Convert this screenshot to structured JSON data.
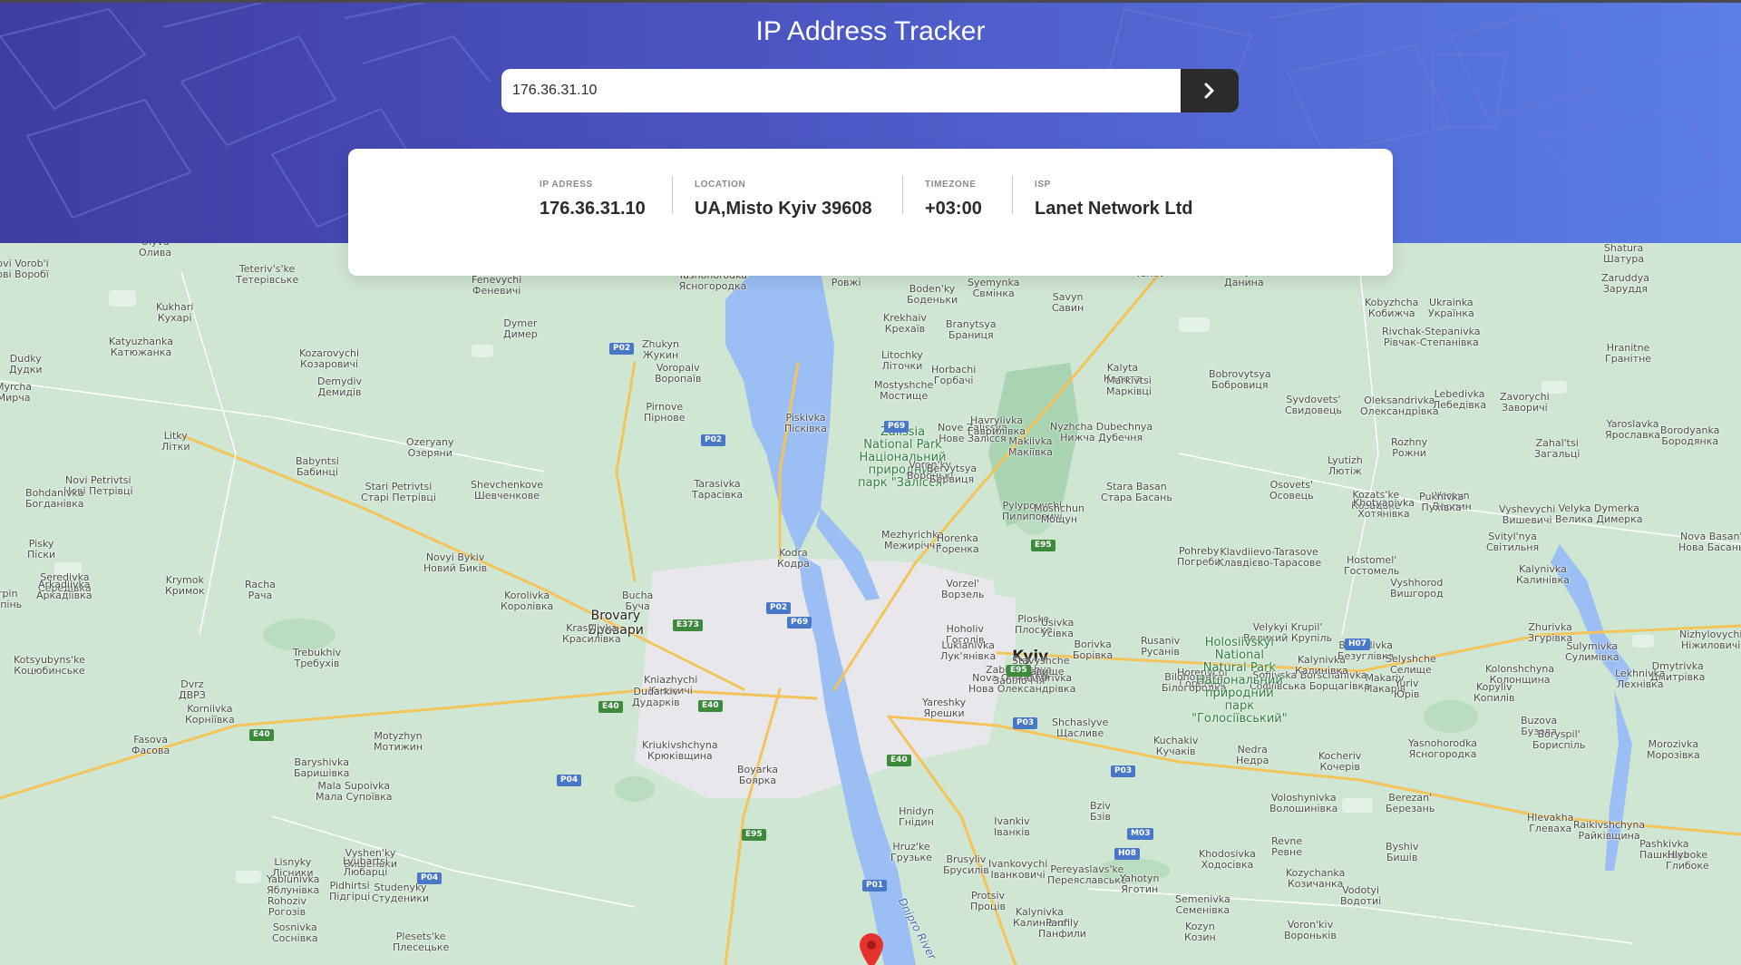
{
  "header": {
    "title": "IP Address Tracker",
    "search": {
      "value": "176.36.31.10",
      "placeholder": ""
    },
    "submit_icon": "chevron-right-icon"
  },
  "info": [
    {
      "label": "IP ADRESS",
      "value": "176.36.31.10"
    },
    {
      "label": "LOCATION",
      "value": "UA,Misto Kyiv 39608"
    },
    {
      "label": "TIMEZONE",
      "value": "+03:00"
    },
    {
      "label": "ISP",
      "value": "Lanet Network Ltd"
    }
  ],
  "colors": {
    "header_gradient_start": "#3f3ca0",
    "header_gradient_end": "#5b7ee6",
    "button_dark": "#2b2b2b",
    "map_green": "#cfe6d2",
    "water": "#9bbff4",
    "urban": "#e8e8ec",
    "marker_red": "#e5322d"
  },
  "map": {
    "marker_icon": "location-pin-icon",
    "labels": [
      {
        "text": "Olyva\nОлива",
        "cls": ""
      },
      {
        "text": "Novi Vorob'i\nНові Воробї",
        "cls": ""
      },
      {
        "text": "Teteriv's'ke\nТетерівське",
        "cls": ""
      },
      {
        "text": "Kukhari\nКухарі",
        "cls": ""
      },
      {
        "text": "Fenevychi\nФеневичі",
        "cls": ""
      },
      {
        "text": "Yasnohorodka\nЯсногородка",
        "cls": ""
      },
      {
        "text": "Rovzhi\nРовжі",
        "cls": ""
      },
      {
        "text": "Boden'ky\nБоденьки",
        "cls": ""
      },
      {
        "text": "Syemynka\nСвмінка",
        "cls": ""
      },
      {
        "text": "Savyn\nСавин",
        "cls": ""
      },
      {
        "text": "Yerkiv",
        "cls": ""
      },
      {
        "text": "Danyna\nДанина",
        "cls": ""
      },
      {
        "text": "Shatura\nШатура",
        "cls": ""
      },
      {
        "text": "Zaruddya\nЗаруддя",
        "cls": ""
      },
      {
        "text": "Katyuzhanka\nКатюжанка",
        "cls": ""
      },
      {
        "text": "Dymer\nДимер",
        "cls": ""
      },
      {
        "text": "Zhukyn\nЖукин",
        "cls": ""
      },
      {
        "text": "Krekhaiv\nКрехаїв",
        "cls": ""
      },
      {
        "text": "Branytsya\nБраниця",
        "cls": ""
      },
      {
        "text": "Kobyzhcha\nКобижча",
        "cls": ""
      },
      {
        "text": "Ukrainka\nУкраїнка",
        "cls": ""
      },
      {
        "text": "Dudky\nДудки",
        "cls": ""
      },
      {
        "text": "Kozarovychi\nКозаровичі",
        "cls": ""
      },
      {
        "text": "Voropaiv\nВоропаїв",
        "cls": ""
      },
      {
        "text": "Litochky\nЛіточки",
        "cls": ""
      },
      {
        "text": "Horbachi\nГорбачі",
        "cls": ""
      },
      {
        "text": "Rivchak-Stepanivka\nРівчак-Степанівка",
        "cls": ""
      },
      {
        "text": "Hranitne\nГранітне",
        "cls": ""
      },
      {
        "text": "Myrcha\nМирча",
        "cls": ""
      },
      {
        "text": "Demydiv\nДемидів",
        "cls": ""
      },
      {
        "text": "Pirnove\nПірнове",
        "cls": ""
      },
      {
        "text": "Mostyshche\nМостище",
        "cls": ""
      },
      {
        "text": "Kalyta\nКалита",
        "cls": ""
      },
      {
        "text": "Markivtsi\nМарківці",
        "cls": ""
      },
      {
        "text": "Bobrovytsya\nБобровиця",
        "cls": ""
      },
      {
        "text": "Syvdovets'\nСвидовець",
        "cls": ""
      },
      {
        "text": "Oleksandrivka\nОлександрівка",
        "cls": ""
      },
      {
        "text": "Lebedivka\nЛебедівка",
        "cls": ""
      },
      {
        "text": "Zavorychi\nЗаворичі",
        "cls": ""
      },
      {
        "text": "Piskivka\nПісківка",
        "cls": ""
      },
      {
        "text": "Nyzhcha Dubechnya\nНижча Дубечня",
        "cls": ""
      },
      {
        "text": "Litky\nЛітки",
        "cls": ""
      },
      {
        "text": "Zalissia\nNational Park\nНаціональний\nприродний\nпарк \"Залісся\"",
        "cls": "park"
      },
      {
        "text": "Nove Zalissya\nНове Залісся",
        "cls": ""
      },
      {
        "text": "Havrylivka\nГаврилівка",
        "cls": ""
      },
      {
        "text": "Lyutizh\nЛютіж",
        "cls": ""
      },
      {
        "text": "Rozhny\nРожни",
        "cls": ""
      },
      {
        "text": "Yaroslavka\nЯрославка",
        "cls": ""
      },
      {
        "text": "Ozeryany\nОзеряни",
        "cls": ""
      },
      {
        "text": "Voron'ky\nВоронькі",
        "cls": ""
      },
      {
        "text": "Makiivka\nМакіївка",
        "cls": ""
      },
      {
        "text": "Zahal'tsi\nЗагальці",
        "cls": ""
      },
      {
        "text": "Borodyanka\nБородянка",
        "cls": ""
      },
      {
        "text": "Babyntsi\nБабинці",
        "cls": ""
      },
      {
        "text": "Stari Petrivtsi\nСтарі Петрівці",
        "cls": ""
      },
      {
        "text": "Shevchenkove\nШевченкове",
        "cls": ""
      },
      {
        "text": "Bervytsya\nБервиця",
        "cls": ""
      },
      {
        "text": "Stara Basan\nСтара Басань",
        "cls": ""
      },
      {
        "text": "Osovets'\nОсовець",
        "cls": ""
      },
      {
        "text": "Kozats'ke\nКозацьке",
        "cls": ""
      },
      {
        "text": "Verpyn\nВерпин",
        "cls": ""
      },
      {
        "text": "Vyshevychi\nВишевичі",
        "cls": ""
      },
      {
        "text": "Novi Petrivtsi\nНові Петрівці",
        "cls": ""
      },
      {
        "text": "Bohdanivka\nБогданівка",
        "cls": ""
      },
      {
        "text": "Tarasivka\nТарасівка",
        "cls": ""
      },
      {
        "text": "Pylypovychi\nПилиповичі",
        "cls": ""
      },
      {
        "text": "Moshchun\nМощун",
        "cls": ""
      },
      {
        "text": "Khotyanivka\nХотянівка",
        "cls": ""
      },
      {
        "text": "Pukhivka\nПухівка",
        "cls": ""
      },
      {
        "text": "Velyka Dymerka\nВелика Димерка",
        "cls": ""
      },
      {
        "text": "Pisky\nПіски",
        "cls": ""
      },
      {
        "text": "Novyi Bykiv\nНовий Биків",
        "cls": ""
      },
      {
        "text": "Mezhyrichka\nМежиріччя",
        "cls": ""
      },
      {
        "text": "Klavdiievo-Tarasove\nКлавдієво-Тарасове",
        "cls": ""
      },
      {
        "text": "Hostomel'\nГостомель",
        "cls": ""
      },
      {
        "text": "Vyshhorod\nВишгород",
        "cls": ""
      },
      {
        "text": "Svityl'nya\nСвітильня",
        "cls": ""
      },
      {
        "text": "Nova Basan'\nНова Басань",
        "cls": ""
      },
      {
        "text": "Seredivka\nСередівка",
        "cls": ""
      },
      {
        "text": "Krymok\nКримок",
        "cls": ""
      },
      {
        "text": "Kodra\nКодра",
        "cls": ""
      },
      {
        "text": "Horenka\nГоренка",
        "cls": ""
      },
      {
        "text": "Pohreby\nПогреби",
        "cls": ""
      },
      {
        "text": "Kalynivka\nКалинівка",
        "cls": ""
      },
      {
        "text": "Arkadiivka\nАркадіївка",
        "cls": ""
      },
      {
        "text": "Racha\nРача",
        "cls": ""
      },
      {
        "text": "Korolivka\nКоролівка",
        "cls": ""
      },
      {
        "text": "Bucha\nБуча",
        "cls": ""
      },
      {
        "text": "Vorzel'\nВорзель",
        "cls": ""
      },
      {
        "text": "Ploske\nПлоске",
        "cls": ""
      },
      {
        "text": "Irpin\nІрпінь",
        "cls": ""
      },
      {
        "text": "Brovary\nБровари",
        "cls": "town"
      },
      {
        "text": "Krasylivka\nКрасилівка",
        "cls": ""
      },
      {
        "text": "Hoholiv\nГоголів",
        "cls": ""
      },
      {
        "text": "Usivka\nУсівка",
        "cls": ""
      },
      {
        "text": "Rusaniv\nРусанів",
        "cls": ""
      },
      {
        "text": "Velykyi Krupil'\nВеликий Крупіль",
        "cls": ""
      },
      {
        "text": "Zhurivka\nЗгурівка",
        "cls": ""
      },
      {
        "text": "Nizhylovychi\nНіжиловичі",
        "cls": ""
      },
      {
        "text": "Kotsyubyns'ke\nКоцюбинське",
        "cls": ""
      },
      {
        "text": "Trebukhiv\nТребухів",
        "cls": ""
      },
      {
        "text": "Lukianivka\nЛук'янівка",
        "cls": ""
      },
      {
        "text": "Kyiv\nКиїв",
        "cls": "big"
      },
      {
        "text": "Borivka\nБорівка",
        "cls": ""
      },
      {
        "text": "Makariv\nМакарів",
        "cls": ""
      },
      {
        "text": "Kolonshchyna\nКолонщина",
        "cls": ""
      },
      {
        "text": "Dmytrivka\nДмитрівка",
        "cls": ""
      },
      {
        "text": "Dvrz\nДВРЗ",
        "cls": ""
      },
      {
        "text": "Kniazhychi\nКняжичі",
        "cls": ""
      },
      {
        "text": "Dudarkiv\nДударків",
        "cls": ""
      },
      {
        "text": "Nova Oleksandrivka\nНова Олександрівка",
        "cls": ""
      },
      {
        "text": "Horenychi\nГореничі",
        "cls": ""
      },
      {
        "text": "Sofiivska Borschahivka\nСофіївська Борщагівка",
        "cls": ""
      },
      {
        "text": "Kalynivka\nКалинівка",
        "cls": ""
      },
      {
        "text": "Yuriv\nЮрів",
        "cls": ""
      },
      {
        "text": "Kopyliv\nКопилів",
        "cls": ""
      },
      {
        "text": "Buzova\nБузова",
        "cls": ""
      },
      {
        "text": "Korniivka\nКорніївка",
        "cls": ""
      },
      {
        "text": "Yareshky\nЯрешки",
        "cls": ""
      },
      {
        "text": "Zabilochchya\nЗабілоччя",
        "cls": ""
      },
      {
        "text": "Stavyshche\nСтавище",
        "cls": ""
      },
      {
        "text": "Bilohorodka\nБілогородка",
        "cls": ""
      },
      {
        "text": "Holosiivskyi\nNational\nNatural Park\nНаціональний\nприродний\nпарк\n\"Голосіївський\"",
        "cls": "park"
      },
      {
        "text": "Bezuhlivka\nБезуглівка",
        "cls": ""
      },
      {
        "text": "Selyshche\nСелище",
        "cls": ""
      },
      {
        "text": "Sulymivka\nСулимівка",
        "cls": ""
      },
      {
        "text": "Lekhnivka\nЛехнівка",
        "cls": ""
      },
      {
        "text": "Fasova\nФасова",
        "cls": ""
      },
      {
        "text": "Motyzhyn\nМотижин",
        "cls": ""
      },
      {
        "text": "Kriukivshchyna\nКрюківщина",
        "cls": ""
      },
      {
        "text": "Shchaslyve\nЩасливе",
        "cls": ""
      },
      {
        "text": "Kuchakiv\nКучаків",
        "cls": ""
      },
      {
        "text": "Nedra\nНедра",
        "cls": ""
      },
      {
        "text": "Kocheriv\nКочерів",
        "cls": ""
      },
      {
        "text": "Yasnohorodka\nЯсногородка",
        "cls": ""
      },
      {
        "text": "Boryspil'\nБориспіль",
        "cls": ""
      },
      {
        "text": "Morozivka\nМорозівка",
        "cls": ""
      },
      {
        "text": "Baryshivka\nБаришівка",
        "cls": ""
      },
      {
        "text": "Mala Supoivka\nМала Супоївка",
        "cls": ""
      },
      {
        "text": "Boyarka\nБоярка",
        "cls": ""
      },
      {
        "text": "Hnidyn\nГнідин",
        "cls": ""
      },
      {
        "text": "Ivankiv\nІванків",
        "cls": ""
      },
      {
        "text": "Bziv\nБзів",
        "cls": ""
      },
      {
        "text": "Voloshynivka\nВолошинівка",
        "cls": ""
      },
      {
        "text": "Berezan'\nБерезань",
        "cls": ""
      },
      {
        "text": "Raikivshchyna\nРайківщина",
        "cls": ""
      },
      {
        "text": "Pashkivka\nПашківка",
        "cls": ""
      },
      {
        "text": "Lisnyky\nЛісники",
        "cls": ""
      },
      {
        "text": "Vyshen'ky\nВишеньки",
        "cls": ""
      },
      {
        "text": "Hruz'ke\nГрузьке",
        "cls": ""
      },
      {
        "text": "Brusyliv\nБрусилів",
        "cls": ""
      },
      {
        "text": "Ivankovychi\nІванковичі",
        "cls": ""
      },
      {
        "text": "Khodosivka\nХодосівка",
        "cls": ""
      },
      {
        "text": "Revne\nРевне",
        "cls": ""
      },
      {
        "text": "Byshiv\nБишів",
        "cls": ""
      },
      {
        "text": "Hlevakha\nГлеваха",
        "cls": ""
      },
      {
        "text": "Hlyboke\nГлибоке",
        "cls": ""
      },
      {
        "text": "Lyubartsi\nЛюбарці",
        "cls": ""
      },
      {
        "text": "Pereyaslavs'ke\nПереяславське",
        "cls": ""
      },
      {
        "text": "Yahotyn\nЯготин",
        "cls": ""
      },
      {
        "text": "Kozychanka\nКозичанка",
        "cls": ""
      },
      {
        "text": "Yablunivka\nЯблунівка",
        "cls": ""
      },
      {
        "text": "Pidhirtsi\nПідгірці",
        "cls": ""
      },
      {
        "text": "Protsiv\nПроців",
        "cls": ""
      },
      {
        "text": "Semenivka\nСеменівка",
        "cls": ""
      },
      {
        "text": "Vodotyi\nВодотиі",
        "cls": ""
      },
      {
        "text": "Sosnivka\nСоснівка",
        "cls": ""
      },
      {
        "text": "Plesets'ke\nПлесецьке",
        "cls": ""
      },
      {
        "text": "Kalynivka\nКалинівка",
        "cls": ""
      },
      {
        "text": "Kozyn\nКозин",
        "cls": ""
      },
      {
        "text": "Voron'kiv\nВороньків",
        "cls": ""
      },
      {
        "text": "Rohoziv\nРогозів",
        "cls": ""
      },
      {
        "text": "Studenyky\nСтуденики",
        "cls": ""
      },
      {
        "text": "Panfily\nПанфили",
        "cls": ""
      },
      {
        "text": "Dnipro River",
        "cls": "river"
      }
    ],
    "road_badges": [
      {
        "text": "P02",
        "cls": "p"
      },
      {
        "text": "P02",
        "cls": "p"
      },
      {
        "text": "P69",
        "cls": "p"
      },
      {
        "text": "P02",
        "cls": "p"
      },
      {
        "text": "P69",
        "cls": "p"
      },
      {
        "text": "E373",
        "cls": "e"
      },
      {
        "text": "E95",
        "cls": "e"
      },
      {
        "text": "E95",
        "cls": "e"
      },
      {
        "text": "E40",
        "cls": "e"
      },
      {
        "text": "E40",
        "cls": "e"
      },
      {
        "text": "E40",
        "cls": "e"
      },
      {
        "text": "E40",
        "cls": "e"
      },
      {
        "text": "P03",
        "cls": "p"
      },
      {
        "text": "P04",
        "cls": "p"
      },
      {
        "text": "P03",
        "cls": "p"
      },
      {
        "text": "M03",
        "cls": "h"
      },
      {
        "text": "H08",
        "cls": "h"
      },
      {
        "text": "H07",
        "cls": "h"
      },
      {
        "text": "E95",
        "cls": "e"
      },
      {
        "text": "P04",
        "cls": "p"
      },
      {
        "text": "P01",
        "cls": "p"
      }
    ]
  }
}
